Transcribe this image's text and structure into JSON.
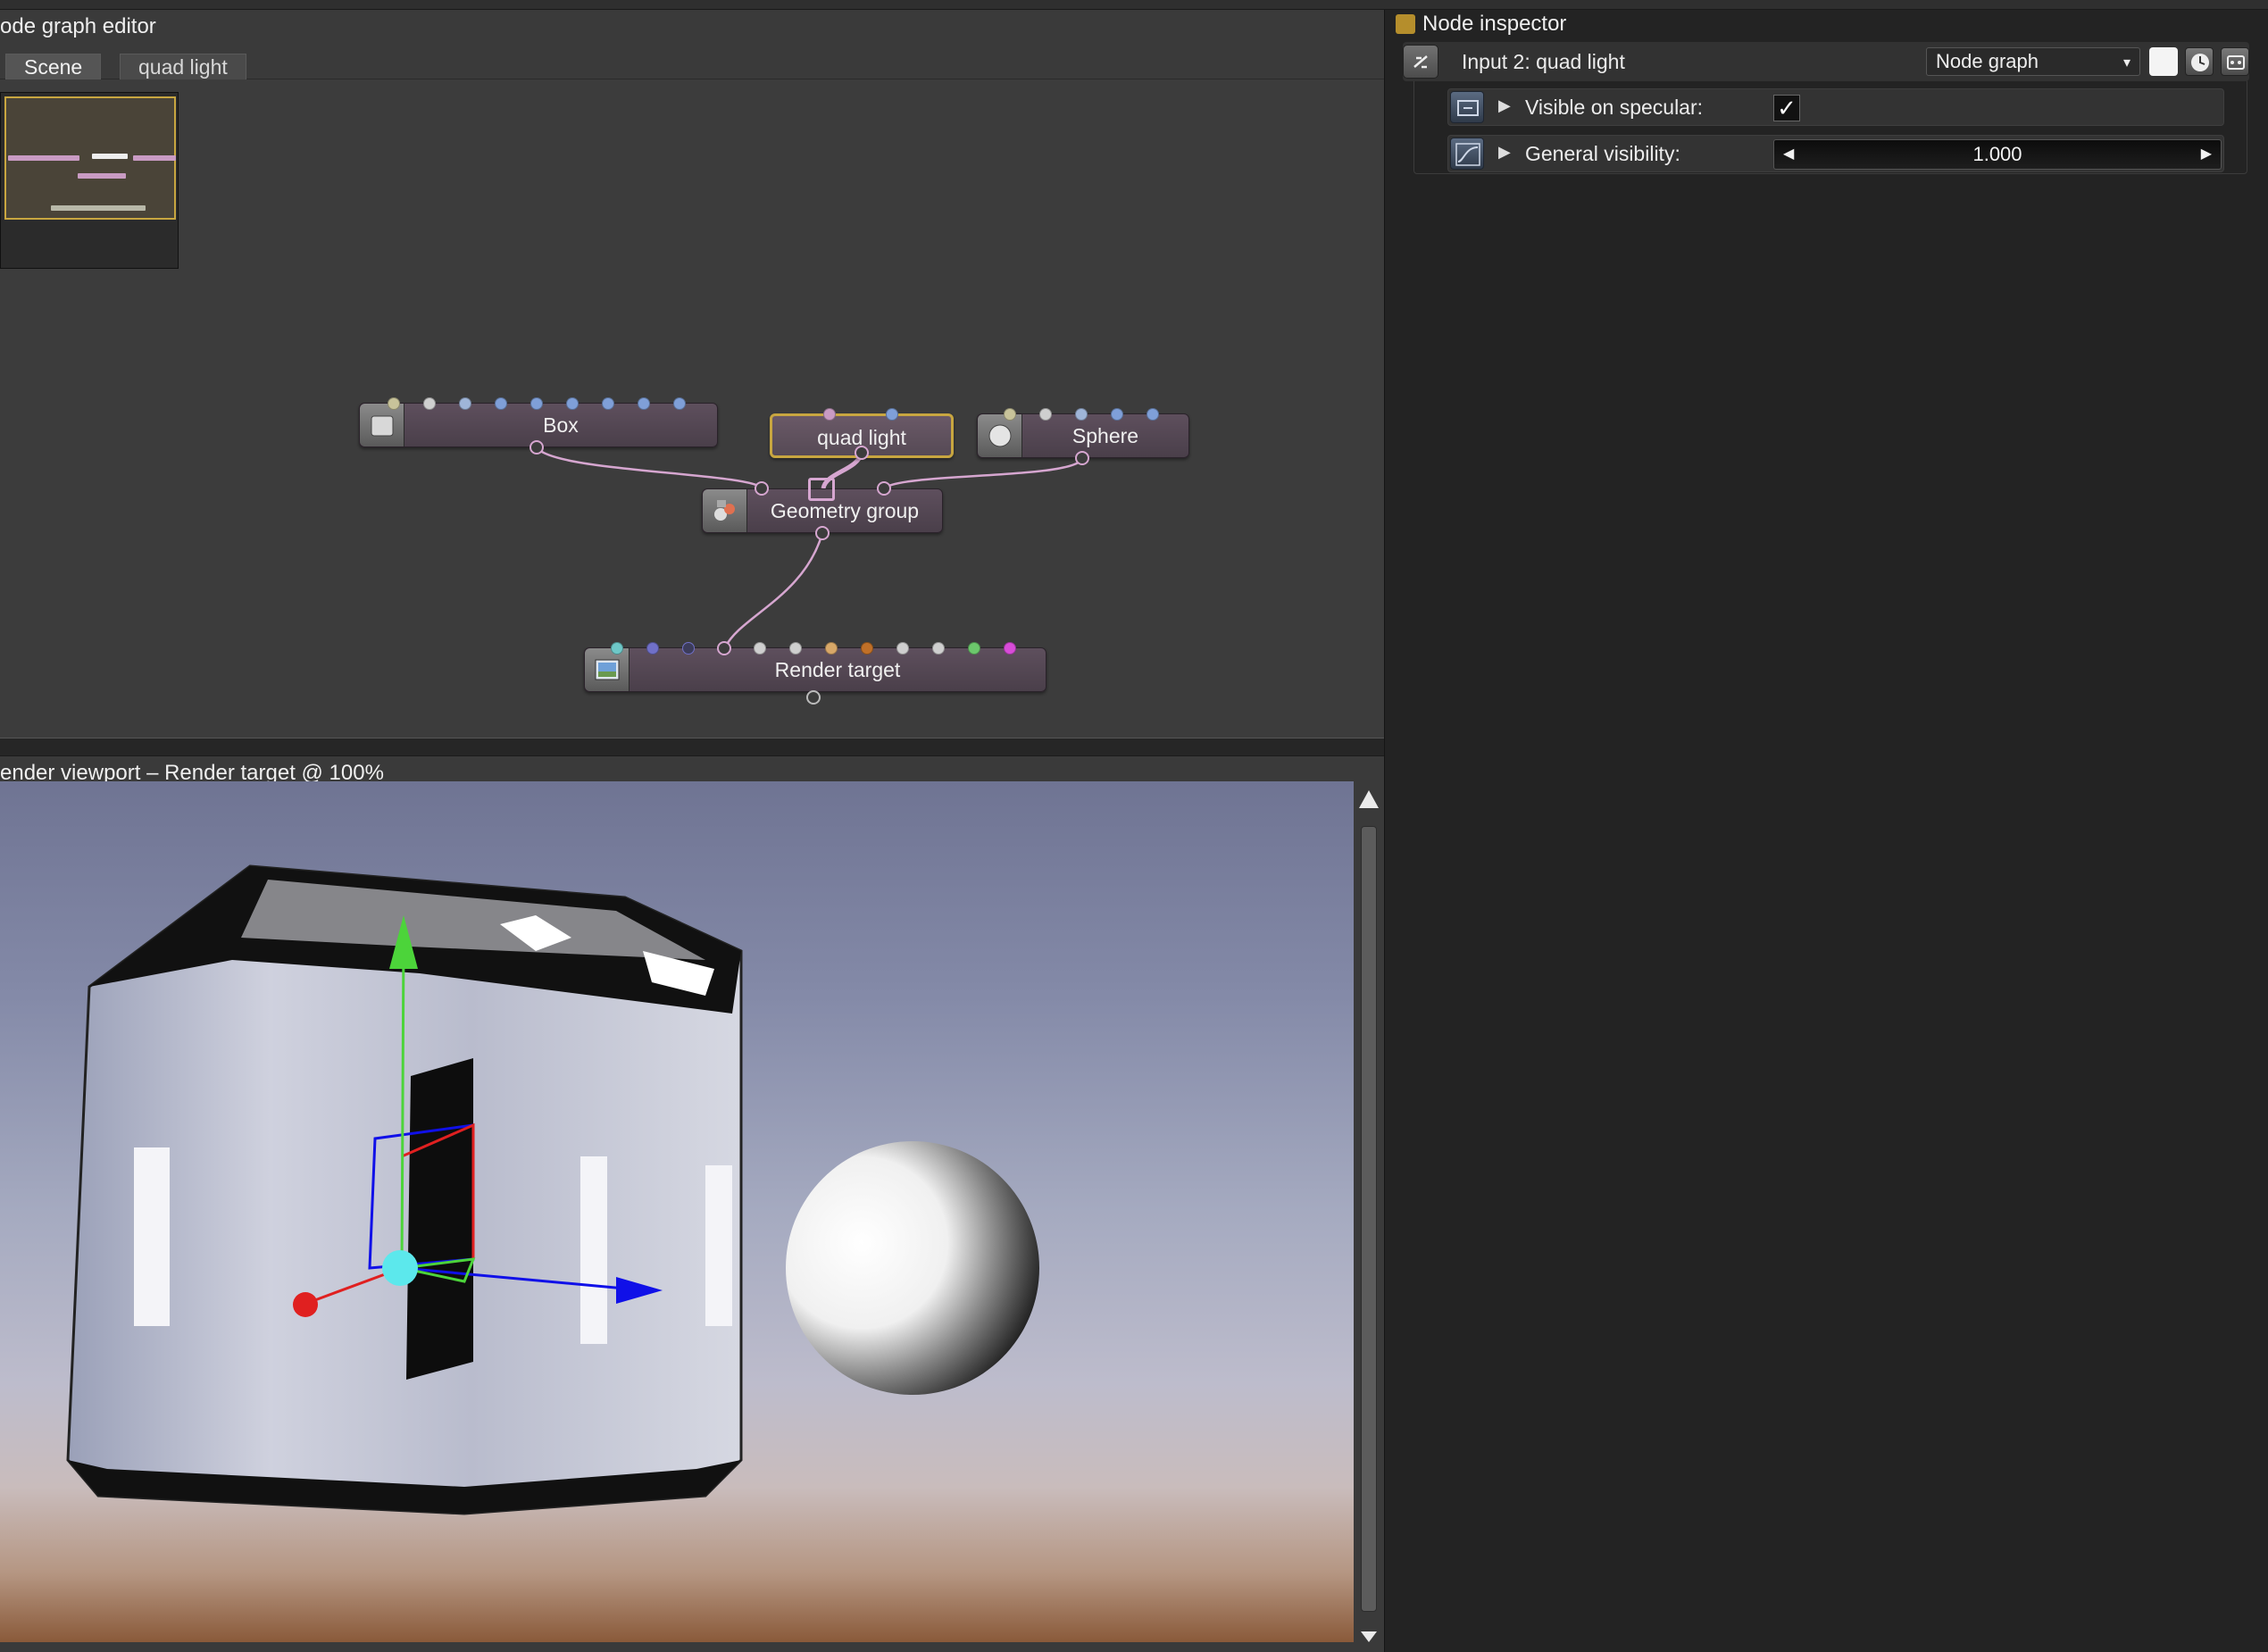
{
  "node_graph_editor": {
    "title": "ode graph editor",
    "tabs": [
      {
        "label": "Scene"
      },
      {
        "label": "quad light"
      }
    ],
    "nodes": {
      "box": "Box",
      "quad_light": "quad light",
      "sphere": "Sphere",
      "geometry_group": "Geometry group",
      "render_target": "Render target"
    }
  },
  "render_viewport": {
    "title": "ender viewport – Render target @ 100%"
  },
  "node_inspector": {
    "title": "Node inspector",
    "input_label": "Input 2: quad light",
    "mode_dropdown": "Node graph",
    "params": [
      {
        "label": "Visible on specular:",
        "checked": true,
        "check_glyph": "✓"
      },
      {
        "label": "General visibility:",
        "value": "1.000"
      }
    ]
  },
  "colors": {
    "accent_gold": "#c8a640",
    "wire_pink": "#d6a6d0",
    "node_body": "#4e424d",
    "gizmo_green": "#4cd43a",
    "gizmo_blue": "#1010e8",
    "gizmo_red": "#e02020",
    "gizmo_center": "#5ce8ec"
  }
}
